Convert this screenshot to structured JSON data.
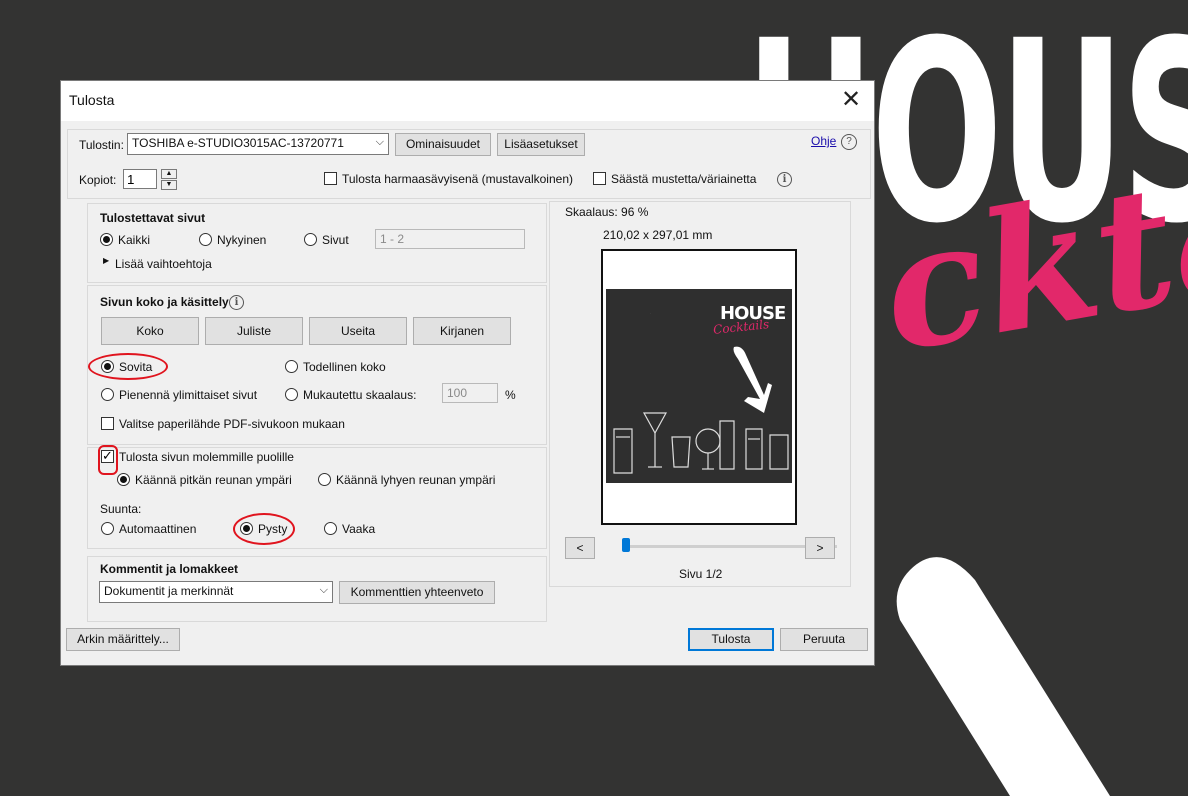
{
  "background": {
    "word_1": "HOUS",
    "word_2": "ckta",
    "colors": {
      "background": "#333332",
      "accent": "#e2286a"
    }
  },
  "dialog": {
    "title": "Tulosta",
    "close_icon": "close-icon",
    "printer_label": "Tulostin:",
    "printer_value": "TOSHIBA e-STUDIO3015AC-13720771",
    "properties_button": "Ominaisuudet",
    "advanced_button": "Lisäasetukset",
    "help_link": "Ohje",
    "copies_label": "Kopiot:",
    "copies_value": "1",
    "grayscale_label": "Tulosta harmaasävyisenä (mustavalkoinen)",
    "grayscale_checked": false,
    "save_ink_label": "Säästä mustetta/väriainetta",
    "save_ink_checked": false
  },
  "pages_to_print": {
    "title": "Tulostettavat sivut",
    "options": [
      "Kaikki",
      "Nykyinen",
      "Sivut"
    ],
    "selected": "Kaikki",
    "range_value": "1 - 2",
    "more_options": "Lisää vaihtoehtoja"
  },
  "page_sizing": {
    "title": "Sivun koko ja käsittely",
    "tabs": [
      "Koko",
      "Juliste",
      "Useita",
      "Kirjanen"
    ],
    "fit": "Sovita",
    "actual_size": "Todellinen koko",
    "shrink": "Pienennä ylimittaiset sivut",
    "custom_scale": "Mukautettu skaalaus:",
    "custom_scale_value": "100",
    "percent": "%",
    "selected": "Sovita",
    "paper_source": "Valitse paperilähde PDF-sivukoon mukaan",
    "paper_source_checked": false
  },
  "duplex": {
    "label": "Tulosta sivun molemmille puolille",
    "checked": true,
    "long_edge": "Käännä pitkän reunan ympäri",
    "short_edge": "Käännä lyhyen reunan ympäri",
    "selected": "Käännä pitkän reunan ympäri"
  },
  "orientation": {
    "label": "Suunta:",
    "options": [
      "Automaattinen",
      "Pysty",
      "Vaaka"
    ],
    "selected": "Pysty"
  },
  "comments": {
    "title": "Kommentit ja lomakkeet",
    "select_value": "Dokumentit ja merkinnät",
    "summary_button": "Kommenttien yhteenveto"
  },
  "preview": {
    "scale": "Skaalaus:  96 %",
    "dimensions": "210,02 x 297,01 mm",
    "page_label": "Sivu 1/2",
    "prev": "<",
    "next": ">",
    "thumb_house": "HOUSE",
    "thumb_cocktails": "Cocktails",
    "current_page": 1,
    "total_pages": 2
  },
  "footer": {
    "page_setup": "Arkin määrittely...",
    "print": "Tulosta",
    "cancel": "Peruuta"
  }
}
